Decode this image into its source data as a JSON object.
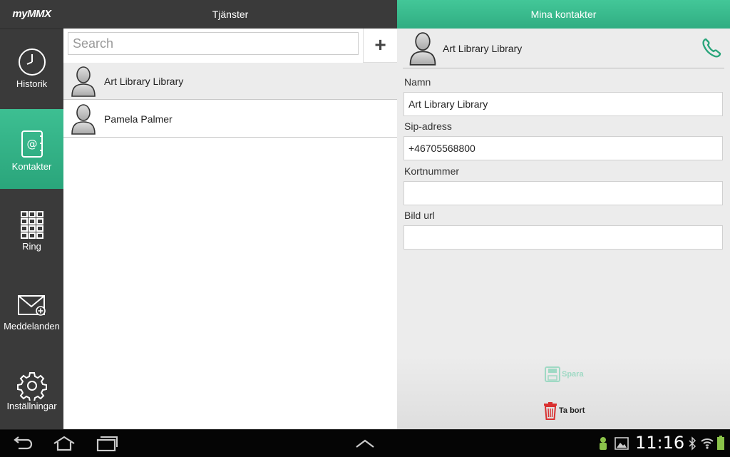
{
  "sidebar": {
    "logo": "myMMX",
    "items": [
      {
        "label": "Historik",
        "icon": "clock-icon",
        "active": false
      },
      {
        "label": "Kontakter",
        "icon": "address-book-icon",
        "active": true
      },
      {
        "label": "Ring",
        "icon": "dialpad-icon",
        "active": false
      },
      {
        "label": "Meddelanden",
        "icon": "envelope-icon",
        "active": false
      },
      {
        "label": "Inställningar",
        "icon": "gear-icon",
        "active": false
      }
    ]
  },
  "middle": {
    "title": "Tjänster",
    "search_placeholder": "Search",
    "add_label": "+",
    "contacts": [
      {
        "name": "Art Library Library",
        "selected": true
      },
      {
        "name": "Pamela Palmer",
        "selected": false
      }
    ]
  },
  "right": {
    "title": "Mina kontakter",
    "contact_name": "Art Library Library",
    "fields": [
      {
        "label": "Namn",
        "value": "Art Library Library"
      },
      {
        "label": "Sip-adress",
        "value": "+46705568800"
      },
      {
        "label": "Kortnummer",
        "value": ""
      },
      {
        "label": "Bild url",
        "value": ""
      }
    ],
    "save_label": "Spara",
    "delete_label": "Ta bort"
  },
  "status_bar": {
    "time": "11:16"
  },
  "colors": {
    "accent": "#36b88a",
    "dark": "#3a3a3a",
    "delete": "#d93030",
    "save_disabled": "#9fd9c4"
  }
}
